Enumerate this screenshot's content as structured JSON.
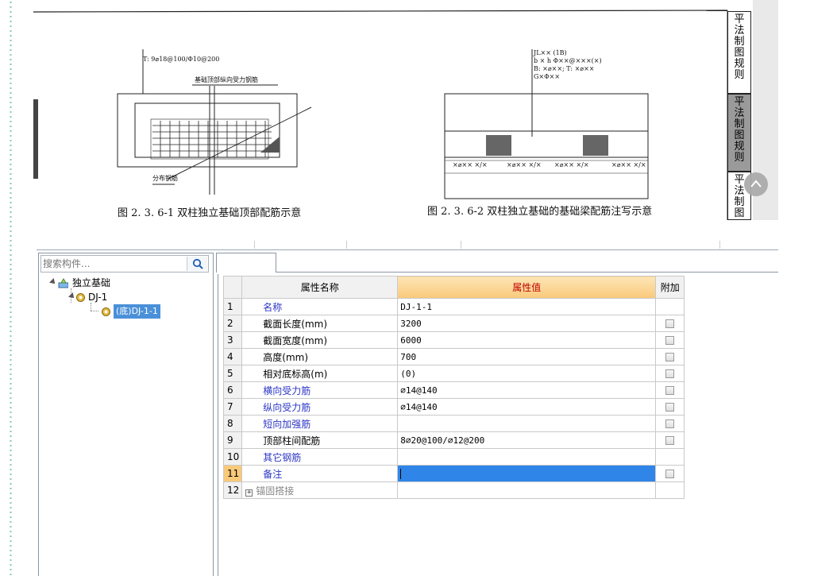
{
  "document": {
    "figure1": {
      "top_label": "T: 9⌀18@100/Φ10@200",
      "inner_label": "基础顶部纵向受力钢筋",
      "bottom_label": "分布钢筋",
      "caption": "图 2. 3. 6-1  双柱独立基础顶部配筋示意"
    },
    "figure2": {
      "annot_lines": [
        "JL×× (1B)",
        "b × h  Φ××@×××(×)",
        "B: ×⌀××; T: ×⌀××",
        "G×Φ××"
      ],
      "rebar_labels": [
        "×⌀×× ×/×",
        "×⌀×× ×/×",
        "×⌀×× ×/×",
        "×⌀×× ×/×"
      ],
      "caption": "图 2. 3. 6-2  双柱独立基础的基础梁配筋注写示意"
    },
    "side_tabs": [
      "平法制图规则",
      "平法制图规则",
      "平法制图"
    ]
  },
  "tree": {
    "search_placeholder": "搜索构件...",
    "nodes": [
      {
        "label": "独立基础",
        "level": 0
      },
      {
        "label": "DJ-1",
        "level": 1
      },
      {
        "label": "(底)DJ-1-1",
        "level": 2,
        "selected": true
      }
    ]
  },
  "grid": {
    "headers": {
      "index": "",
      "name": "属性名称",
      "value": "属性值",
      "attach": "附加"
    },
    "rows": [
      {
        "num": "1",
        "name": "名称",
        "value": "DJ-1-1",
        "link": true,
        "checkbox": false
      },
      {
        "num": "2",
        "name": "截面长度(mm)",
        "value": "3200",
        "link": false,
        "checkbox": true
      },
      {
        "num": "3",
        "name": "截面宽度(mm)",
        "value": "6000",
        "link": false,
        "checkbox": true
      },
      {
        "num": "4",
        "name": "高度(mm)",
        "value": "700",
        "link": false,
        "checkbox": true
      },
      {
        "num": "5",
        "name": "相对底标高(m)",
        "value": "(0)",
        "link": false,
        "checkbox": true
      },
      {
        "num": "6",
        "name": "横向受力筋",
        "value": "⌀14@140",
        "link": true,
        "checkbox": true
      },
      {
        "num": "7",
        "name": "纵向受力筋",
        "value": "⌀14@140",
        "link": true,
        "checkbox": true
      },
      {
        "num": "8",
        "name": "短向加强筋",
        "value": "",
        "link": true,
        "checkbox": true
      },
      {
        "num": "9",
        "name": "顶部柱间配筋",
        "value": "8⌀20@100/⌀12@200",
        "link": false,
        "checkbox": true
      },
      {
        "num": "10",
        "name": "其它钢筋",
        "value": "",
        "link": true,
        "checkbox": false
      },
      {
        "num": "11",
        "name": "备注",
        "value": "",
        "link": true,
        "checkbox": true,
        "active": true
      },
      {
        "num": "12",
        "name": "锚固搭接",
        "value": "",
        "link": false,
        "checkbox": false,
        "expandable": true
      }
    ]
  }
}
